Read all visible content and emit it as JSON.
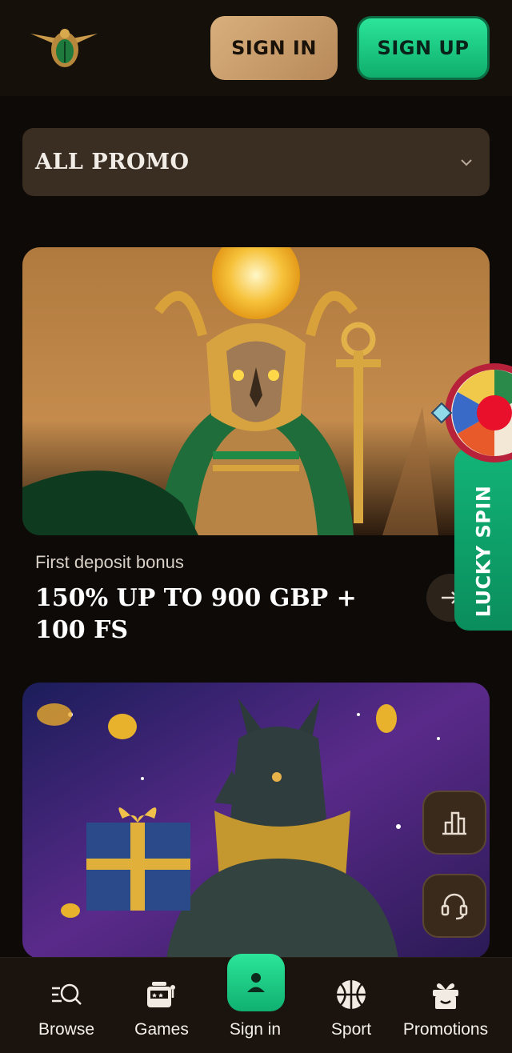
{
  "header": {
    "signin_label": "SIGN IN",
    "signup_label": "SIGN UP",
    "logo_icon": "scarab-logo-icon"
  },
  "filter": {
    "selected": "ALL PROMO",
    "icon": "chevron-down-icon"
  },
  "promos": [
    {
      "subtitle": "First deposit bonus",
      "title": "150% UP TO 900 GBP + 100 FS",
      "image": "falcon-god-horus-illustration",
      "action_icon": "arrow-right-icon"
    },
    {
      "image": "anubis-with-gift-illustration"
    }
  ],
  "lucky_spin": {
    "label": "LUCKY SPIN",
    "icon": "fortune-wheel-icon"
  },
  "floating": {
    "stats_icon": "bar-chart-icon",
    "support_icon": "headset-icon"
  },
  "nav": {
    "items": [
      {
        "label": "Browse",
        "icon": "browse-search-icon"
      },
      {
        "label": "Games",
        "icon": "slot-machine-icon"
      },
      {
        "label": "Sign in",
        "icon": "user-icon"
      },
      {
        "label": "Sport",
        "icon": "basketball-icon"
      },
      {
        "label": "Promotions",
        "icon": "gift-icon"
      }
    ]
  },
  "colors": {
    "background": "#0e0a07",
    "accent_green": "#1fcf86",
    "accent_gold": "#c99d6b"
  }
}
